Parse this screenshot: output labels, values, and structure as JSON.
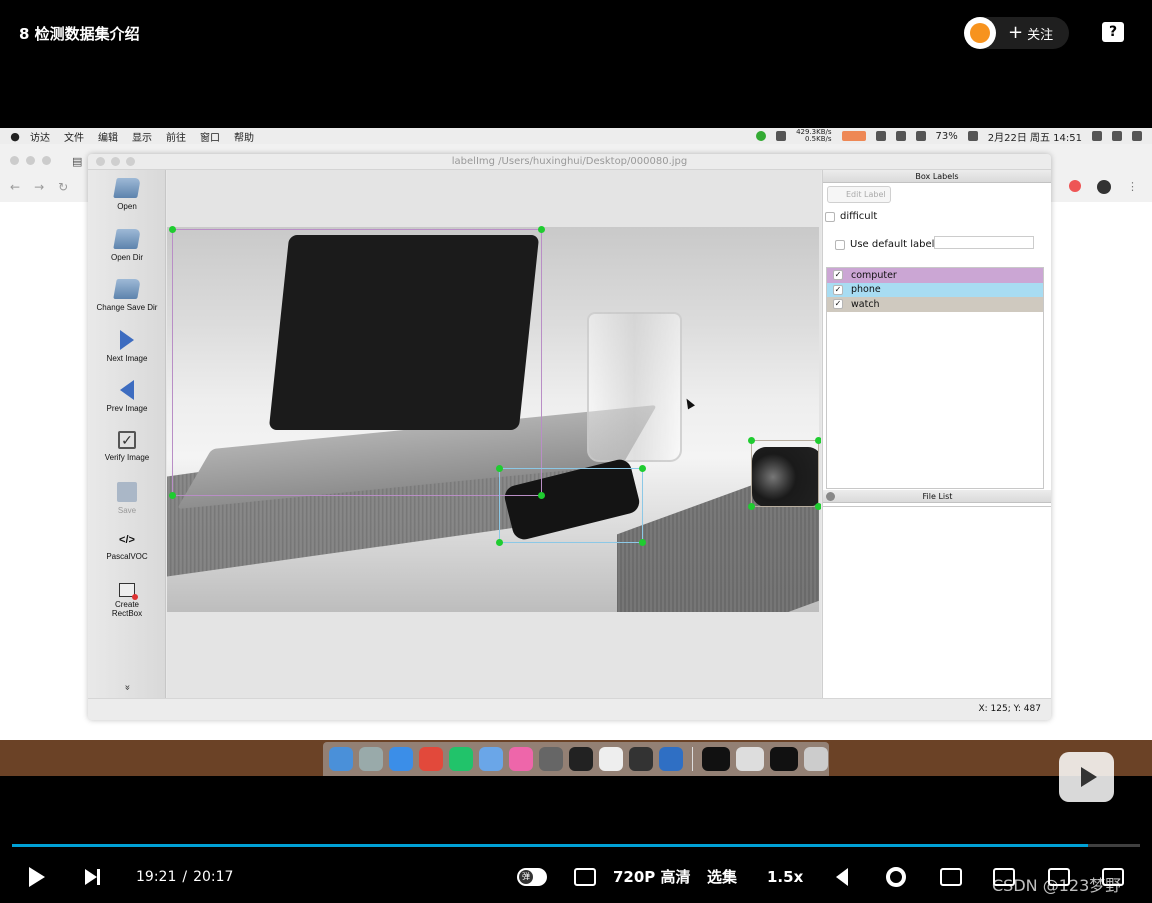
{
  "video": {
    "title": "8 检测数据集介绍",
    "follow_label": "关注",
    "follow_plus": "+",
    "help_glyph": "?"
  },
  "mac": {
    "apple_glyph": "",
    "menu": [
      "访达",
      "文件",
      "编辑",
      "显示",
      "前往",
      "窗口",
      "帮助"
    ],
    "net_speed_up": "429.3KB/s",
    "net_speed_down": "0.5KB/s",
    "battery": "73%",
    "datetime": "2月22日 周五  14:51"
  },
  "labelimg": {
    "window_title": "labelImg /Users/huxinghui/Desktop/000080.jpg",
    "tools": {
      "open": "Open",
      "open_dir": "Open Dir",
      "change_save_dir": "Change Save Dir",
      "next_image": "Next Image",
      "prev_image": "Prev Image",
      "verify_image": "Verify Image",
      "save": "Save",
      "format_glyph": "</>",
      "format": "PascalVOC",
      "create_rectbox_1": "Create",
      "create_rectbox_2": "RectBox",
      "more_glyph": "»"
    },
    "box_labels_header": "Box Labels",
    "edit_label_button": "Edit Label",
    "difficult_label": "difficult",
    "use_default_label": "Use default label",
    "default_label_value": "",
    "labels": [
      {
        "name": "computer",
        "checked": true,
        "color": "#cba6d4"
      },
      {
        "name": "phone",
        "checked": true,
        "color": "#a8dcf2"
      },
      {
        "name": "watch",
        "checked": true,
        "color": "#cfc9bf"
      }
    ],
    "file_list_header": "File List",
    "status_coords": "X: 125; Y: 487"
  },
  "player": {
    "current_time": "19:21",
    "time_separator": "/",
    "duration": "20:17",
    "progress": 0.954,
    "danmaku_glyph": "弹",
    "quality": "720P 高清",
    "episodes": "选集",
    "speed": "1.5x",
    "watermark": "CSDN @123梦野",
    "accent_color": "#00a1d6"
  }
}
